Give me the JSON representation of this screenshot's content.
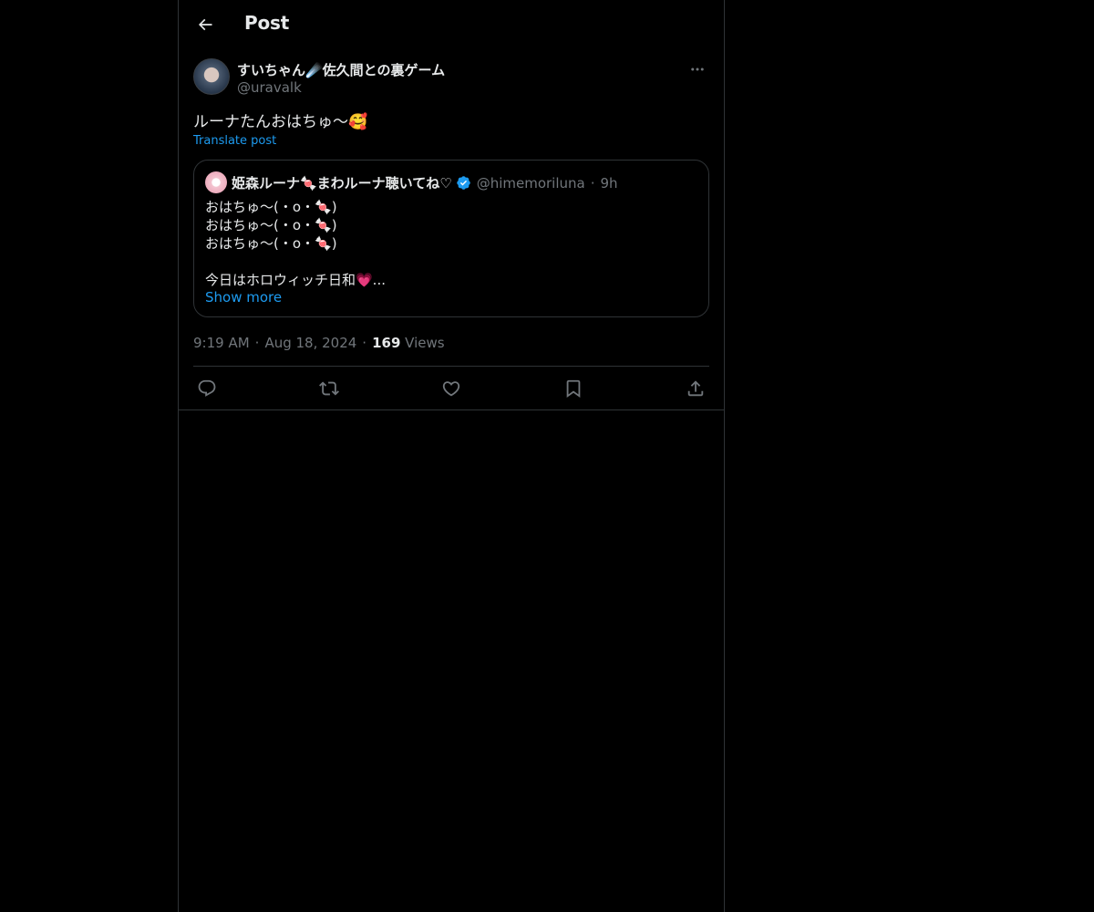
{
  "header": {
    "title": "Post"
  },
  "post": {
    "author_name": "すいちゃん☄️佐久間との裏ゲーム",
    "author_handle": "@uravalk",
    "text": "ルーナたんおはちゅ〜🥰",
    "translate_label": "Translate post",
    "quote": {
      "author_name": "姫森ルーナ🍬まわルーナ聴いてね♡",
      "author_handle": "@himemoriluna",
      "time": "9h",
      "lines": [
        "おはちゅ〜(・o・🍬)",
        "おはちゅ〜(・o・🍬)",
        "おはちゅ〜(・o・🍬)",
        "",
        "今日はホロウィッチ日和💗..."
      ],
      "show_more_label": "Show more"
    },
    "meta": {
      "time": "9:19 AM",
      "date": "Aug 18, 2024",
      "views_count": "169",
      "views_label": "Views"
    }
  },
  "colors": {
    "background": "#000000",
    "text": "#e7e9ea",
    "secondary": "#71767b",
    "accent": "#1d9bf0",
    "border": "#2f3336"
  },
  "icons": [
    "back-arrow-icon",
    "more-icon",
    "verified-icon",
    "reply-icon",
    "repost-icon",
    "like-icon",
    "bookmark-icon",
    "share-icon"
  ]
}
